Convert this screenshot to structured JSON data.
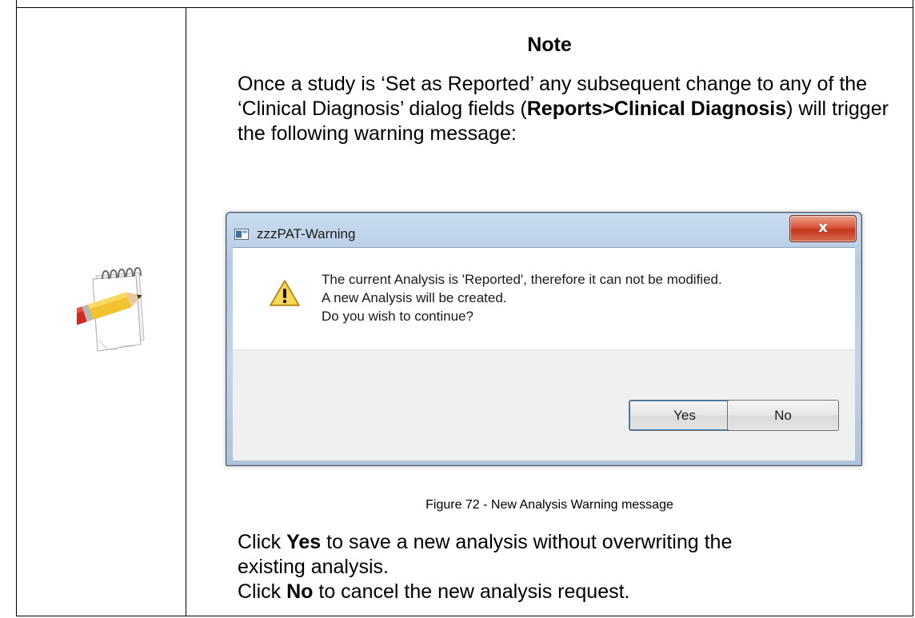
{
  "note": {
    "title": "Note",
    "intro_1": "Once a study is ‘Set as Reported’ any subsequent change to any of the ‘Clinical Diagnosis’ dialog fields (",
    "intro_bold": "Reports>Clinical Diagnosis",
    "intro_2": ") will trigger the following warning message:",
    "icon": "notepad-pencil-icon"
  },
  "dialog": {
    "title": "zzzPAT-Warning",
    "close_glyph": "x",
    "message_line1": "The current Analysis is 'Reported', therefore it can not be modified.",
    "message_line2": "A new  Analysis will be created.",
    "message_line3": "Do you wish to continue?",
    "icon": "warning-icon",
    "yes_label": "Yes",
    "no_label": "No"
  },
  "caption": "Figure 72  - New Analysis Warning message",
  "instructions": {
    "line1_pre": "Click ",
    "line1_bold": "Yes",
    "line1_post": " to save a new analysis without overwriting the",
    "line2": "existing analysis.",
    "line3_pre": "Click ",
    "line3_bold": "No",
    "line3_post": " to cancel the new analysis request."
  }
}
